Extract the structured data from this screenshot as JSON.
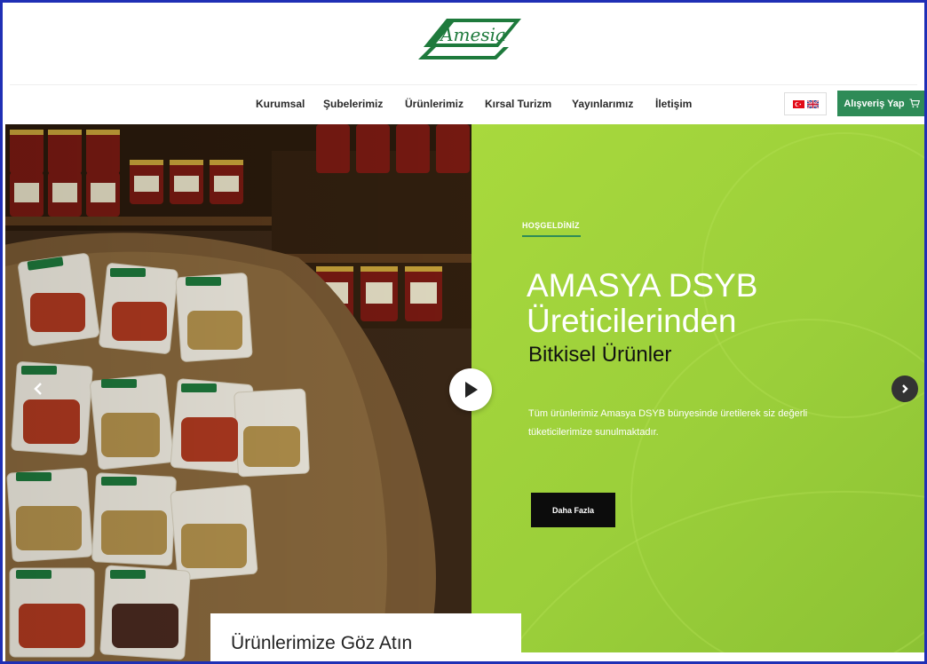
{
  "brand": {
    "logo_text": "Amesia",
    "color": "#1e7a3c"
  },
  "nav": {
    "items": [
      {
        "label": "Kurumsal"
      },
      {
        "label": "Şubelerimiz"
      },
      {
        "label": "Ürünlerimiz"
      },
      {
        "label": "Kırsal Turizm"
      },
      {
        "label": "Yayınlarımız"
      },
      {
        "label": "İletişim"
      }
    ],
    "languages": [
      "tr-flag-icon",
      "uk-flag-icon"
    ],
    "shop_button": "Alışveriş Yap",
    "shop_button_color": "#2e8b57"
  },
  "hero": {
    "eyebrow": "HOŞGELDİNİZ",
    "title_line1": "AMASYA DSYB",
    "title_line2": "Üreticilerinden",
    "title_line3": "Bitkisel Ürünler",
    "description": "Tüm ürünlerimiz Amasya DSYB bünyesinde üretilerek siz değerli tüketicilerimize sunulmaktadır.",
    "button": "Daha Fazla",
    "accent_color": "#a3d53b"
  },
  "products_card": {
    "title": "Ürünlerimize Göz Atın"
  }
}
